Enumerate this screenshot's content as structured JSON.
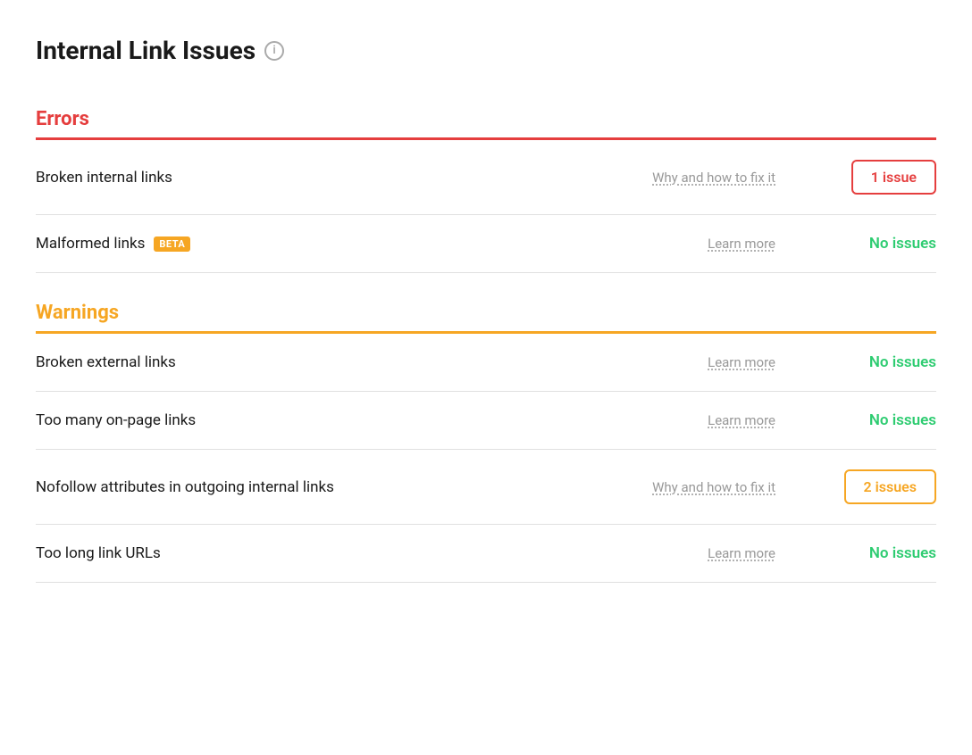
{
  "page": {
    "title": "Internal Link Issues",
    "info_icon_label": "i"
  },
  "errors_section": {
    "title": "Errors",
    "type": "errors",
    "rows": [
      {
        "name": "Broken internal links",
        "link_text": "Why and how to fix it",
        "status_type": "badge",
        "badge_color": "red",
        "badge_text": "1 issue"
      },
      {
        "name": "Malformed links",
        "beta": true,
        "link_text": "Learn more",
        "status_type": "no-issues",
        "status_text": "No issues"
      }
    ]
  },
  "warnings_section": {
    "title": "Warnings",
    "type": "warnings",
    "rows": [
      {
        "name": "Broken external links",
        "link_text": "Learn more",
        "status_type": "no-issues",
        "status_text": "No issues"
      },
      {
        "name": "Too many on-page links",
        "link_text": "Learn more",
        "status_type": "no-issues",
        "status_text": "No issues"
      },
      {
        "name": "Nofollow attributes in outgoing internal links",
        "link_text": "Why and how to fix it",
        "status_type": "badge",
        "badge_color": "orange",
        "badge_text": "2 issues"
      },
      {
        "name": "Too long link URLs",
        "link_text": "Learn more",
        "status_type": "no-issues",
        "status_text": "No issues"
      }
    ]
  }
}
